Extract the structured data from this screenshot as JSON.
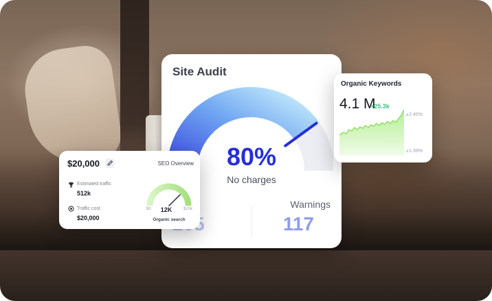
{
  "site_audit": {
    "title": "Site Audit",
    "percentage": "80%",
    "subtitle": "No charges",
    "left_value": "205",
    "warnings_label": "Warnings",
    "warnings_value": "117",
    "score_fraction": 0.8
  },
  "organic_keywords": {
    "title": "Organic Keywords",
    "value": "4.1 M",
    "delta": "+25.3k",
    "tick_top": "+2.45%",
    "tick_bottom": "+1.39%"
  },
  "seo_overview": {
    "amount": "$20,000",
    "title": "SEO Overview",
    "estimated_traffic_label": "Estimated traffic",
    "estimated_traffic_value": "512k",
    "traffic_cost_label": "Traffic cost",
    "traffic_cost_value": "$20,000",
    "gauge_min": "$0",
    "gauge_value": "12K",
    "gauge_max": "$20k",
    "gauge_caption": "Organic search"
  },
  "colors": {
    "accent": "#2530d6",
    "gauge_start": "#a9d8f7",
    "gauge_end": "#3c4ce0",
    "positive": "#3fc281",
    "chart_fill": "#c9f2b3"
  },
  "icons": [
    "edit-icon",
    "trophy-icon",
    "target-icon"
  ]
}
